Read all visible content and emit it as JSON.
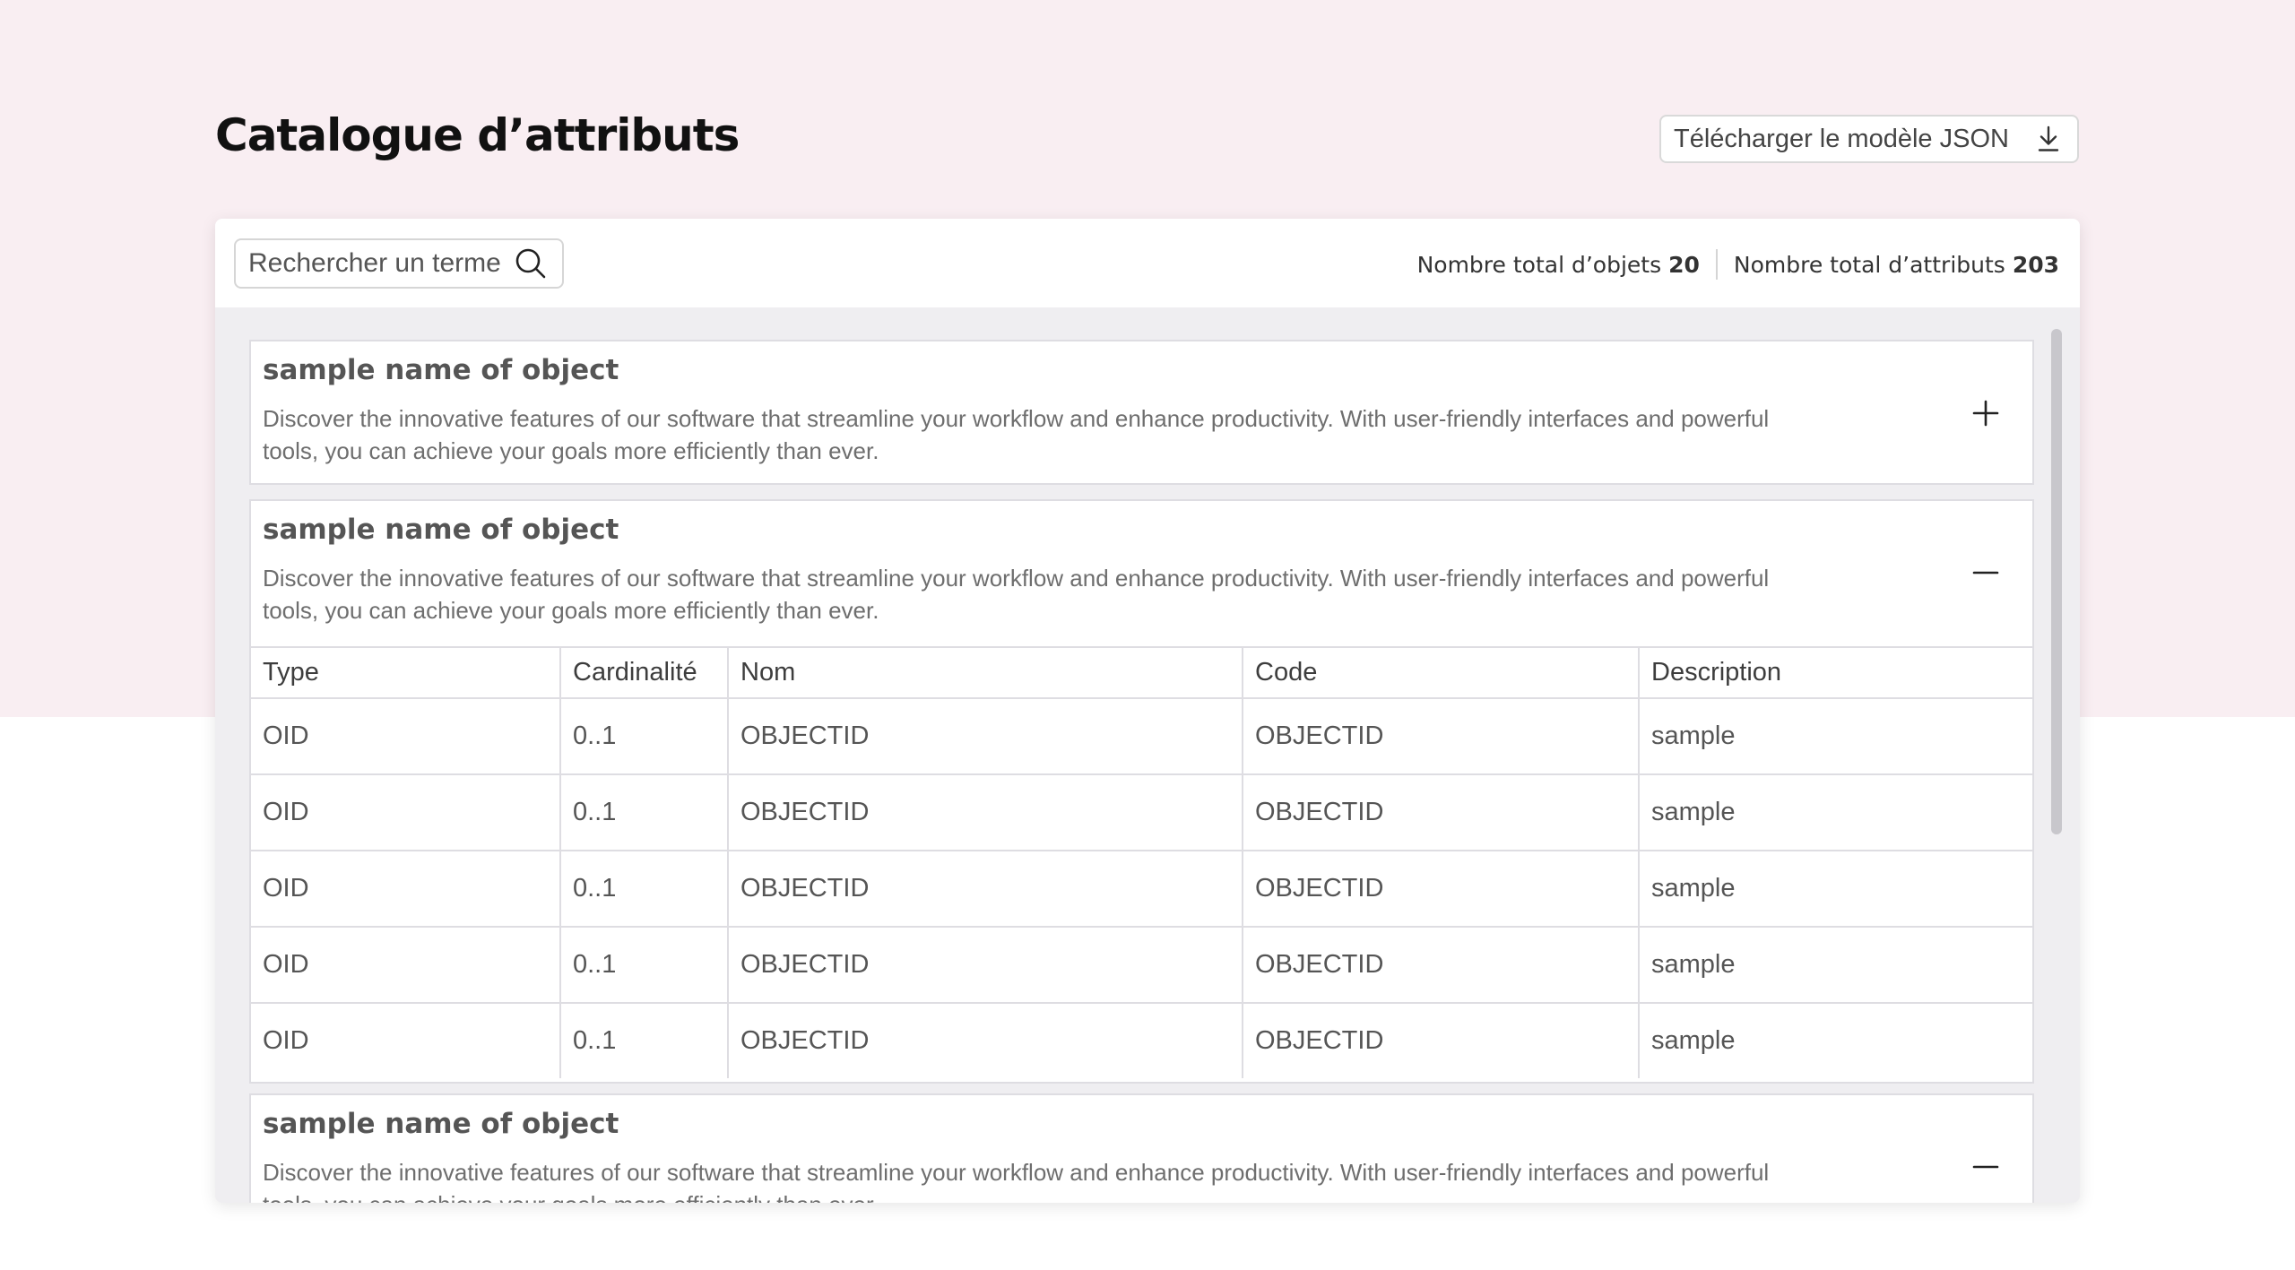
{
  "page": {
    "title": "Catalogue d’attributs",
    "download_label": "Télécharger le modèle JSON"
  },
  "search": {
    "placeholder": "Rechercher un terme"
  },
  "stats": {
    "objects_label": "Nombre total d’objets",
    "objects_count": "20",
    "attributes_label": "Nombre total d’attributs",
    "attributes_count": "203"
  },
  "objects": [
    {
      "name": "sample name of object",
      "description": "Discover the innovative features of our software that streamline your workflow and enhance productivity. With user-friendly interfaces and powerful tools, you can achieve your goals more efficiently than ever.",
      "expanded": false
    },
    {
      "name": "sample name of object",
      "description": "Discover the innovative features of our software that streamline your workflow and enhance productivity. With user-friendly interfaces and powerful tools, you can achieve your goals more efficiently than ever.",
      "expanded": true,
      "table": {
        "headers": [
          "Type",
          "Cardinalité",
          "Nom",
          "Code",
          "Description"
        ],
        "rows": [
          [
            "OID",
            "0..1",
            "OBJECTID",
            "OBJECTID",
            "sample"
          ],
          [
            "OID",
            "0..1",
            "OBJECTID",
            "OBJECTID",
            "sample"
          ],
          [
            "OID",
            "0..1",
            "OBJECTID",
            "OBJECTID",
            "sample"
          ],
          [
            "OID",
            "0..1",
            "OBJECTID",
            "OBJECTID",
            "sample"
          ],
          [
            "OID",
            "0..1",
            "OBJECTID",
            "OBJECTID",
            "sample"
          ]
        ]
      }
    },
    {
      "name": "sample name of object",
      "description": "Discover the innovative features of our software that streamline your workflow and enhance productivity. With user-friendly interfaces and powerful tools, you can achieve your goals more efficiently than ever.",
      "expanded": true
    }
  ],
  "icons": {
    "download": "download-icon",
    "search": "search-icon",
    "expand": "plus-icon",
    "collapse": "minus-icon"
  },
  "colors": {
    "top_band": "#f9eef2",
    "card_body": "#efeef1",
    "panel_border": "#dedde2",
    "scrollbar": "#c8c7cc"
  }
}
